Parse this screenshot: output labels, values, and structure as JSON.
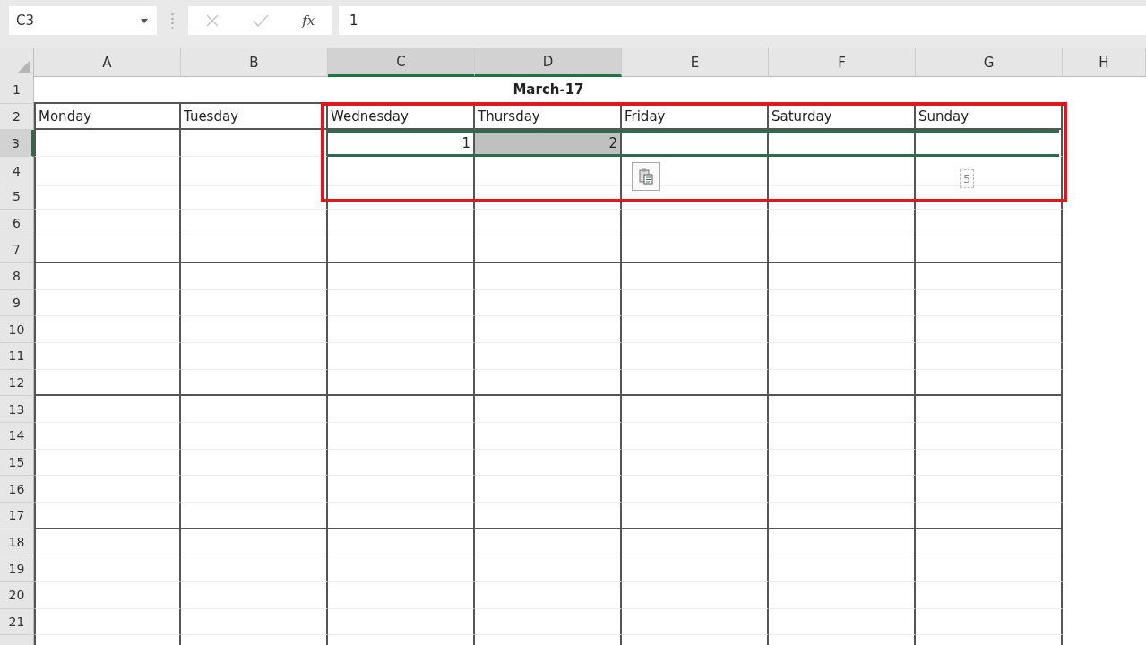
{
  "name_box": "C3",
  "function_label": "fx",
  "formula": "1",
  "columns": [
    {
      "label": "A",
      "selected": false
    },
    {
      "label": "B",
      "selected": false
    },
    {
      "label": "C",
      "selected": true
    },
    {
      "label": "D",
      "selected": true
    },
    {
      "label": "E",
      "selected": false
    },
    {
      "label": "F",
      "selected": false
    },
    {
      "label": "G",
      "selected": false
    },
    {
      "label": "H",
      "selected": false
    }
  ],
  "rows": [
    {
      "label": "1",
      "selected": false
    },
    {
      "label": "2",
      "selected": false
    },
    {
      "label": "3",
      "selected": true
    },
    {
      "label": "4",
      "selected": false
    },
    {
      "label": "5",
      "selected": false
    },
    {
      "label": "6",
      "selected": false
    },
    {
      "label": "7",
      "selected": false
    },
    {
      "label": "8",
      "selected": false
    },
    {
      "label": "9",
      "selected": false
    },
    {
      "label": "10",
      "selected": false
    },
    {
      "label": "11",
      "selected": false
    },
    {
      "label": "12",
      "selected": false
    },
    {
      "label": "13",
      "selected": false
    },
    {
      "label": "14",
      "selected": false
    },
    {
      "label": "15",
      "selected": false
    },
    {
      "label": "16",
      "selected": false
    },
    {
      "label": "17",
      "selected": false
    },
    {
      "label": "18",
      "selected": false
    },
    {
      "label": "19",
      "selected": false
    },
    {
      "label": "20",
      "selected": false
    },
    {
      "label": "21",
      "selected": false
    }
  ],
  "title": "March-17",
  "days": [
    "Monday",
    "Tuesday",
    "Wednesday",
    "Thursday",
    "Friday",
    "Saturday",
    "Sunday"
  ],
  "first_week": [
    {
      "highlighted": false
    },
    {
      "highlighted": false
    },
    {
      "value": "1",
      "highlighted": false
    },
    {
      "value": "2",
      "highlighted": true
    },
    {
      "highlighted": false
    },
    {
      "highlighted": false
    },
    {
      "highlighted": false
    }
  ],
  "fill_preview": "5"
}
